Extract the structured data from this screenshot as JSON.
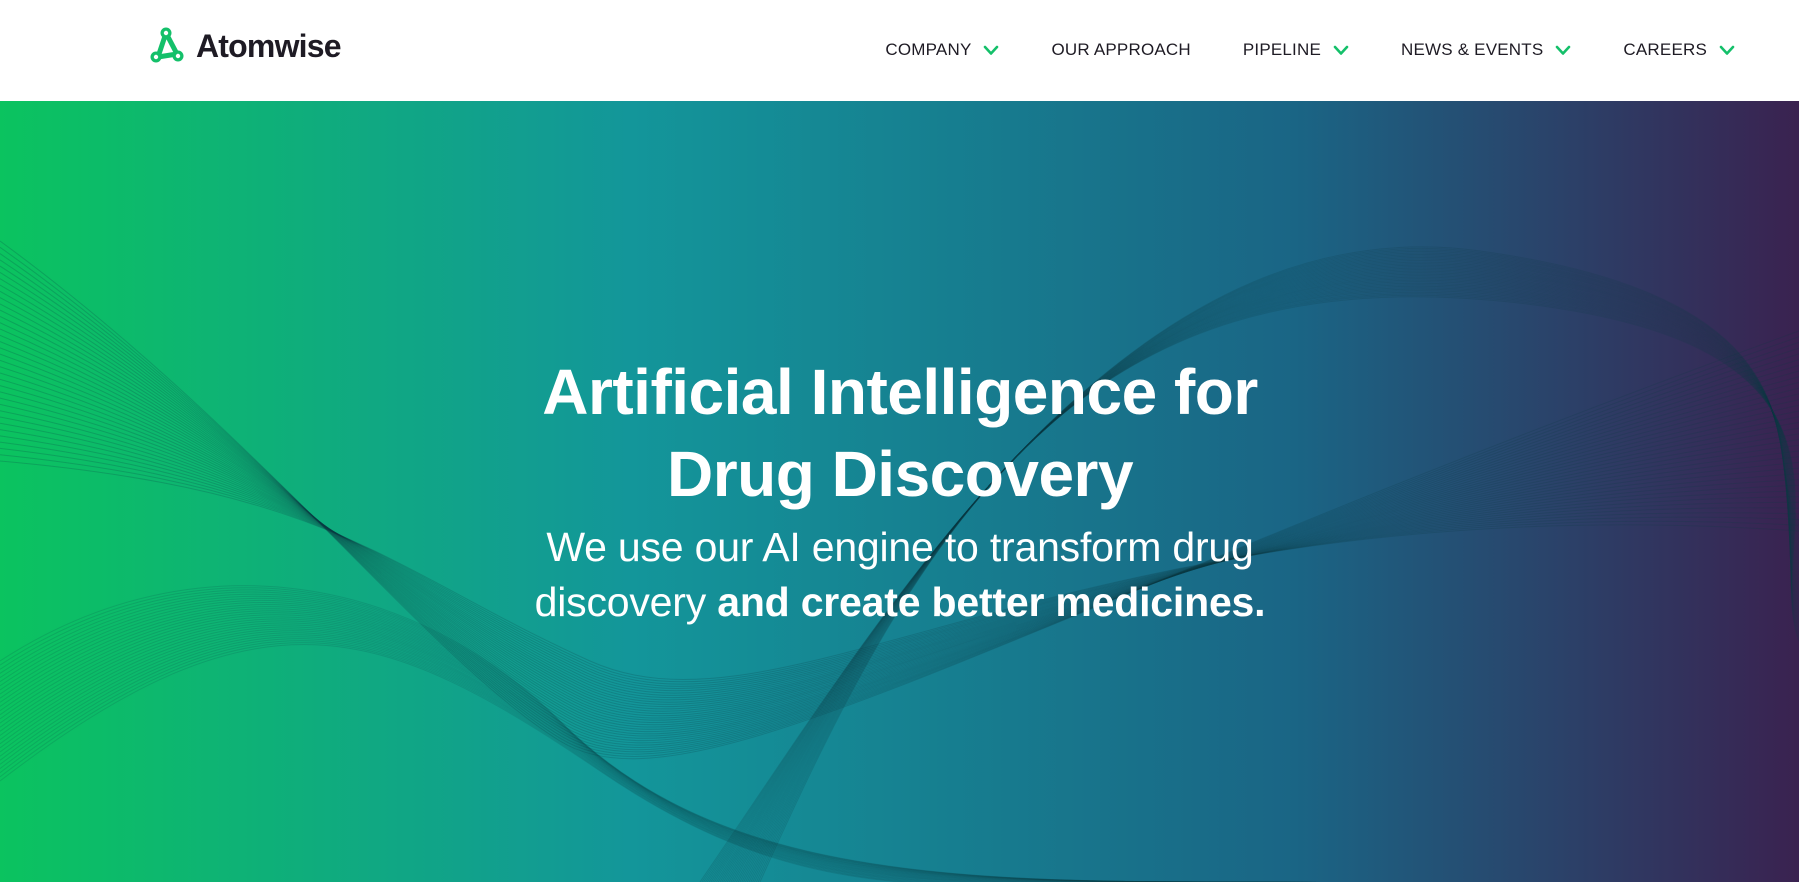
{
  "brand": {
    "name": "Atomwise",
    "accent_color": "#14c06a",
    "text_color": "#1e1b24"
  },
  "nav": {
    "items": [
      {
        "label": "COMPANY",
        "has_dropdown": true,
        "icon": "chevron-down-icon"
      },
      {
        "label": "OUR APPROACH",
        "has_dropdown": false
      },
      {
        "label": "PIPELINE",
        "has_dropdown": true,
        "icon": "chevron-down-icon"
      },
      {
        "label": "NEWS & EVENTS",
        "has_dropdown": true,
        "icon": "chevron-down-icon"
      },
      {
        "label": "CAREERS",
        "has_dropdown": true,
        "icon": "chevron-down-icon"
      }
    ]
  },
  "hero": {
    "title_line1": "Artificial Intelligence for",
    "title_line2": "Drug Discovery",
    "subtitle_regular": "We use our AI engine to transform drug discovery",
    "subtitle_bold": "and create better medicines.",
    "gradient": {
      "left": "#0bc35f",
      "middle": "#13969a",
      "center_right": "#1a6585",
      "right": "#3a2250"
    },
    "background_motif": "wave-lines"
  }
}
